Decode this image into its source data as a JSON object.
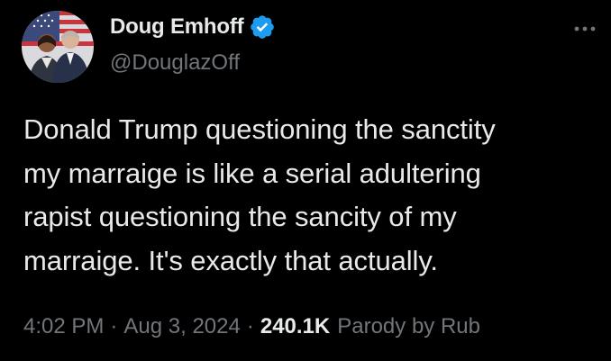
{
  "author": {
    "display_name": "Doug Emhoff",
    "handle": "@DouglazOff",
    "verified": true,
    "avatar_icon": "profile-photo-couple-with-flag",
    "verified_color": "#1d9bf0"
  },
  "tweet": {
    "text": "Donald Trump questioning the sanctity\nmy marraige is like a serial adultering\nrapist questioning the sancity of my\nmarraige. It's exactly that actually."
  },
  "meta": {
    "time": "4:02 PM",
    "separator": "·",
    "date": "Aug 3, 2024",
    "views": "240.1K",
    "views_suffix": "Parody by Rub"
  },
  "menu": {
    "icon": "more-options-icon"
  }
}
